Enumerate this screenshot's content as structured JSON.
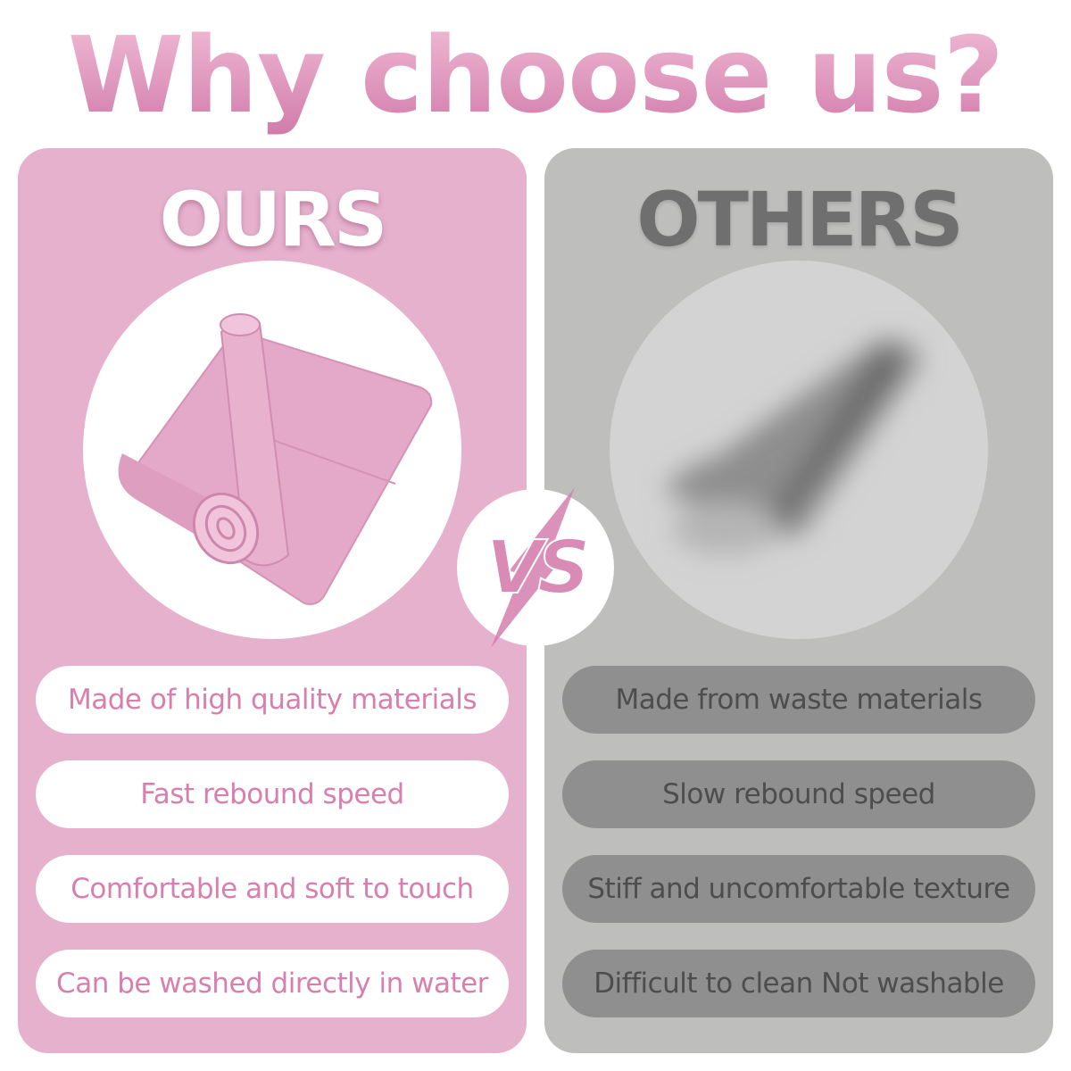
{
  "title": "Why choose us?",
  "ours": {
    "heading": "OURS",
    "image_icon": "pink-yoga-mat",
    "features": [
      "Made of high quality materials",
      "Fast rebound speed",
      "Comfortable and soft to touch",
      "Can be washed directly in water"
    ]
  },
  "vs": {
    "label": "VS",
    "icon": "lightning-bolt-icon"
  },
  "others": {
    "heading": "OTHERS",
    "image_icon": "blurred-yoga-mat",
    "features": [
      "Made from waste materials",
      "Slow rebound speed",
      "Stiff and uncomfortable texture",
      "Difficult to clean Not washable"
    ]
  },
  "colors": {
    "brand_pink": "#e5b1cd",
    "accent_pink": "#d97fae",
    "others_gray": "#bebebd",
    "pill_gray": "#8f8f8f"
  }
}
